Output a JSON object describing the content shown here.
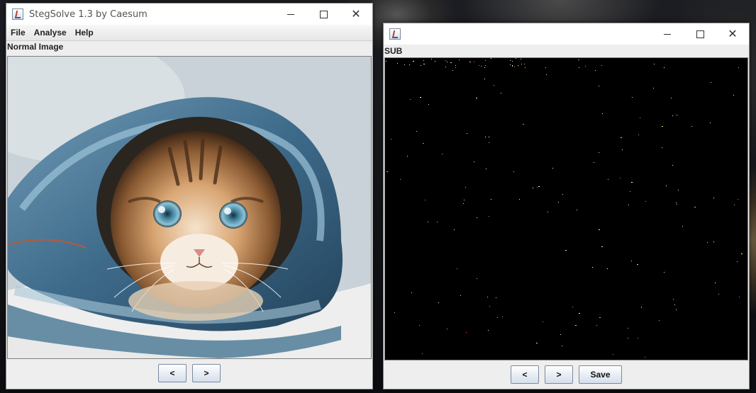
{
  "main_window": {
    "title": "StegSolve 1.3 by Caesum",
    "menu": [
      "File",
      "Analyse",
      "Help"
    ],
    "panel_label": "Normal Image",
    "prev_label": "<",
    "next_label": ">",
    "image_subject": "kitten wrapped in denim"
  },
  "sub_window": {
    "title": "",
    "panel_label": "SUB",
    "prev_label": "<",
    "next_label": ">",
    "save_label": "Save"
  },
  "icons": {
    "app": "java-app-icon",
    "minimize": "minimize-icon",
    "maximize": "maximize-icon",
    "close": "close-icon"
  },
  "colors": {
    "window_bg": "#eeeeee",
    "sub_canvas_bg": "#000000"
  }
}
